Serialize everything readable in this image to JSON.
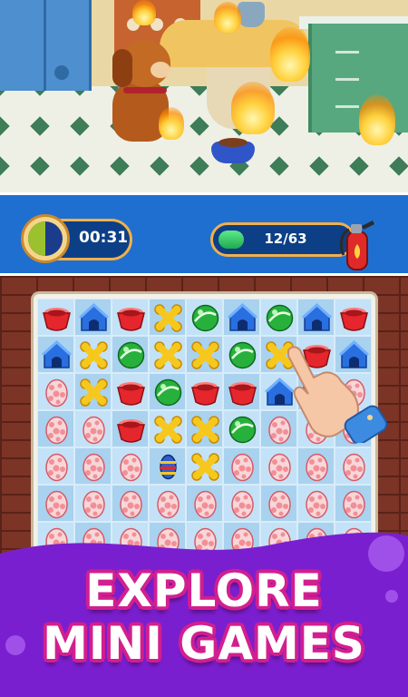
{
  "hud": {
    "timer_text": "00:31",
    "timer_remaining_fraction": 0.5,
    "goal_text": "12/63",
    "goal_progress_fraction": 0.19,
    "goal_icon": "fire-extinguisher-icon"
  },
  "board": {
    "rows": 7,
    "cols": 9,
    "pieces": [
      [
        "bowl",
        "house",
        "bowl",
        "bone",
        "ball",
        "house",
        "ball",
        "house",
        "bowl"
      ],
      [
        "house",
        "bone",
        "ball",
        "bone",
        "bone",
        "ball",
        "bone",
        "bowl",
        "house"
      ],
      [
        "egg",
        "bone",
        "bowl",
        "ball",
        "bowl",
        "bowl",
        "house",
        "bowl",
        "egg"
      ],
      [
        "egg",
        "egg",
        "bowl",
        "bone",
        "bone",
        "ball",
        "egg",
        "egg",
        "egg"
      ],
      [
        "egg",
        "egg",
        "egg",
        "toy",
        "bone",
        "egg",
        "egg",
        "egg",
        "egg"
      ],
      [
        "egg",
        "egg",
        "egg",
        "egg",
        "egg",
        "egg",
        "egg",
        "egg",
        "egg"
      ],
      [
        "egg",
        "egg",
        "egg",
        "egg",
        "egg",
        "egg",
        "egg",
        "egg",
        "egg"
      ]
    ],
    "piece_icons": {
      "bowl": "red-dog-bowl-icon",
      "house": "blue-doghouse-icon",
      "bone": "yellow-bone-icon",
      "ball": "green-ball-icon",
      "egg": "pink-spotted-egg-icon",
      "toy": "striped-toy-icon"
    },
    "colors": {
      "bowl": "#e5262c",
      "house": "#2a6fe0",
      "bone": "#f6c81e",
      "ball": "#27b13c",
      "egg": "#f28f96",
      "toy": "#2f5fcf"
    }
  },
  "banner": {
    "line1": "EXPLORE",
    "line2": "MINI GAMES",
    "background": "#7a1fcf",
    "outline": "#d21f8f"
  }
}
